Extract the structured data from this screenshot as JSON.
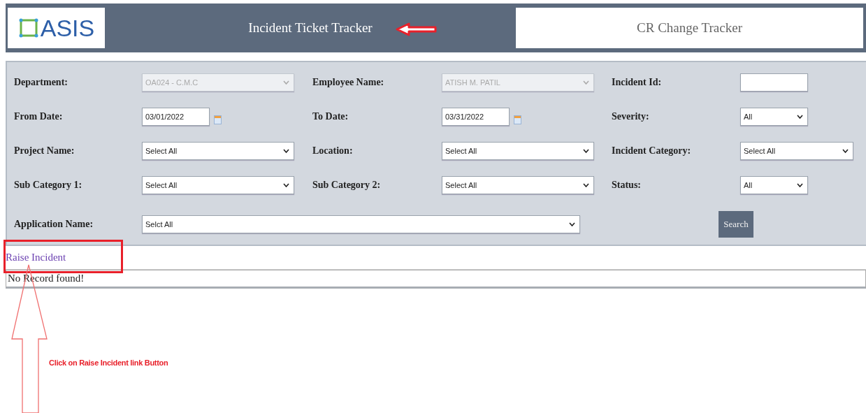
{
  "header": {
    "logo": {
      "text": "ASIS"
    },
    "tabs": [
      {
        "label": "Incident Ticket Tracker",
        "selected": true
      },
      {
        "label": "CR Change Tracker",
        "selected": false
      }
    ]
  },
  "filters": [
    {
      "label": "Department:",
      "kind": "select",
      "value": "OA024 - C.M.C",
      "disabled": true
    },
    {
      "label": "Employee Name:",
      "kind": "select",
      "value": "ATISH M. PATIL",
      "disabled": true
    },
    {
      "label": "Incident Id:",
      "kind": "text",
      "disabled": false
    },
    {
      "label": "From Date:",
      "kind": "date",
      "value": "03/01/2022",
      "disabled": false
    },
    {
      "label": "To Date:",
      "kind": "date",
      "value": "03/31/2022",
      "disabled": false
    },
    {
      "label": "Severity:",
      "kind": "select",
      "value": "All",
      "disabled": false
    },
    {
      "label": "Project Name:",
      "kind": "select",
      "value": "Select All",
      "disabled": false
    },
    {
      "label": "Location:",
      "kind": "select",
      "value": "Select All",
      "disabled": false
    },
    {
      "label": "Incident Category:",
      "kind": "select",
      "value": "Select All",
      "disabled": false
    },
    {
      "label": "Sub Category 1:",
      "kind": "select",
      "value": "Select All",
      "disabled": false
    },
    {
      "label": "Sub Category 2:",
      "kind": "select",
      "value": "Select All",
      "disabled": false
    },
    {
      "label": "Status:",
      "kind": "select",
      "value": "All",
      "disabled": false
    },
    {
      "label": "Application Name:",
      "kind": "select",
      "value": "Selct All",
      "disabled": false
    }
  ],
  "search_button": "Search",
  "raise_link": "Raise Incident",
  "message": "No Record found!",
  "annotation": {
    "note": "Click on Raise Incident link Button"
  }
}
